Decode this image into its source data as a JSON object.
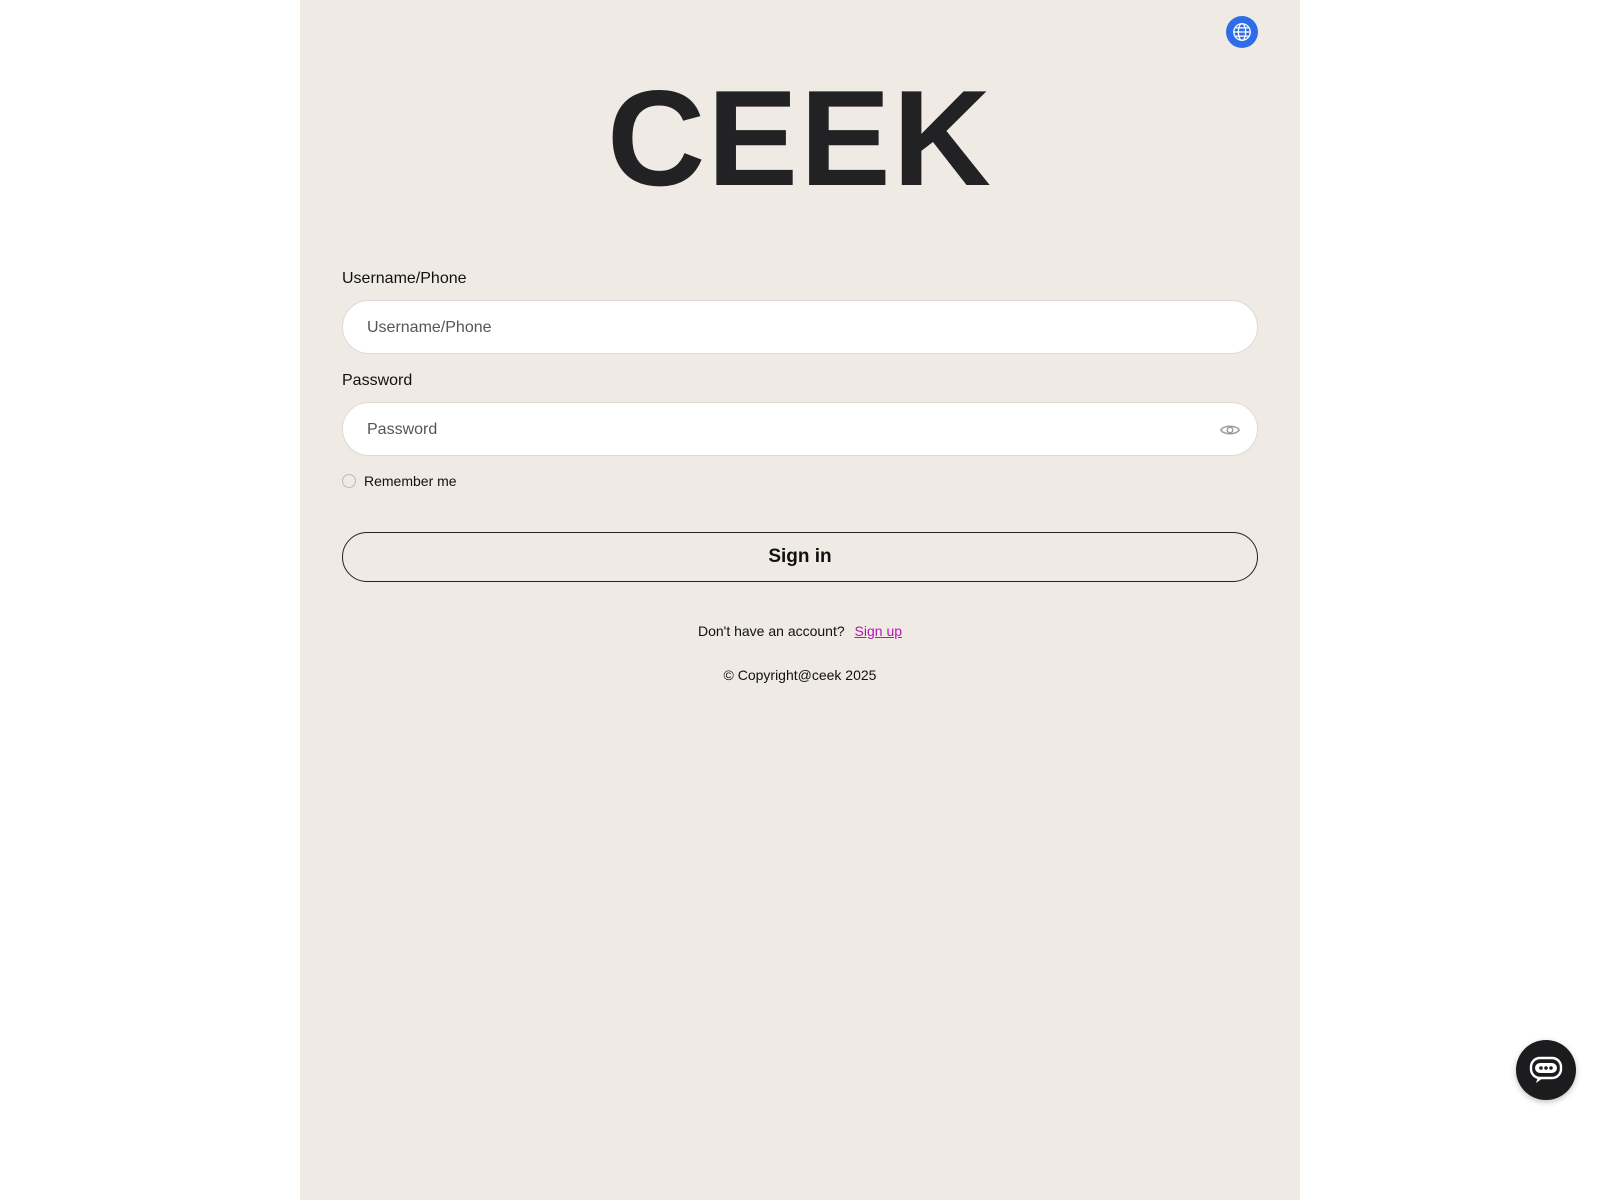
{
  "brand": {
    "logo_text": "CEEK"
  },
  "header": {
    "language_icon": "globe-icon"
  },
  "login_form": {
    "username_label": "Username/Phone",
    "username_placeholder": "Username/Phone",
    "username_value": "",
    "password_label": "Password",
    "password_placeholder": "Password",
    "password_value": "",
    "password_toggle_icon": "eye-icon",
    "remember_label": "Remember me",
    "remember_checked": false,
    "submit_label": "Sign in"
  },
  "footer": {
    "signup_prompt": "Don't have an account?",
    "signup_link": "Sign up",
    "copyright": "© Copyright@ceek 2025"
  },
  "chat": {
    "icon": "chat-bot-icon"
  },
  "colors": {
    "panel_background": "#efeae4",
    "accent_blue": "#2f6de8",
    "link_color": "#b517b5",
    "chat_button": "#1c1c1e"
  }
}
